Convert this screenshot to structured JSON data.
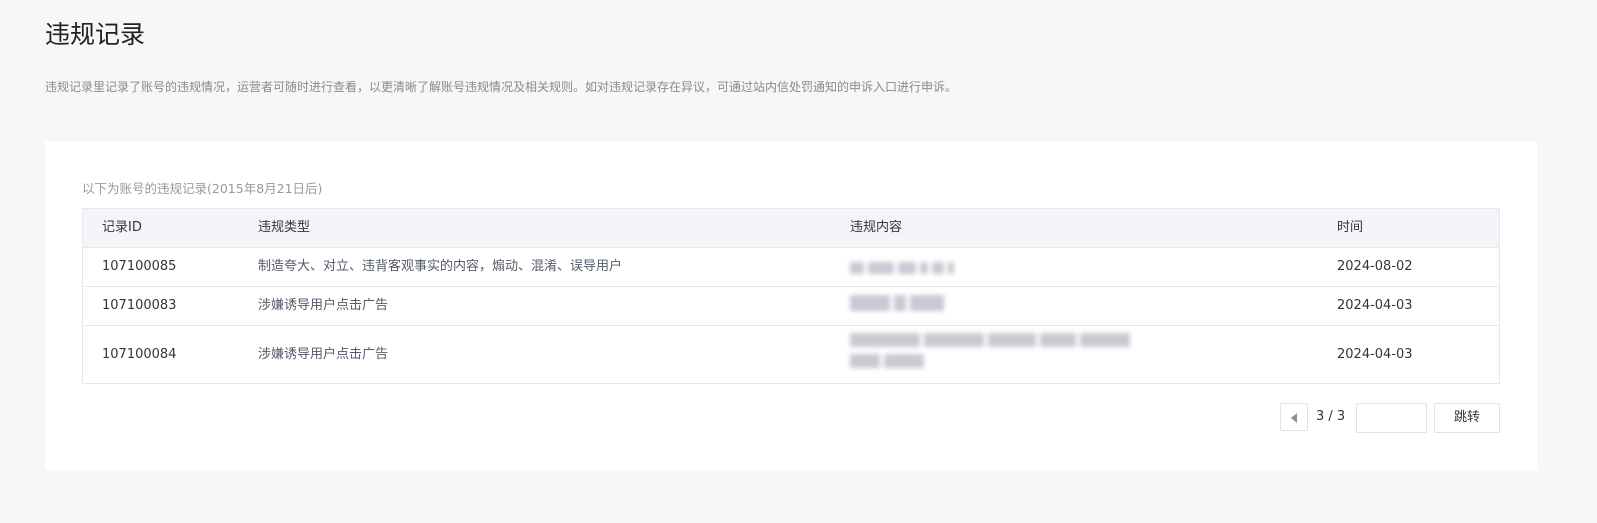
{
  "page": {
    "title": "违规记录",
    "description": "违规记录里记录了账号的违规情况，运营者可随时进行查看，以更清晰了解账号违规情况及相关规则。如对违规记录存在异议，可通过站内信处罚通知的申诉入口进行申诉。"
  },
  "records": {
    "caption": "以下为账号的违规记录(2015年8月21日后)",
    "columns": {
      "id": "记录ID",
      "type": "违规类型",
      "content": "违规内容",
      "time": "时间"
    },
    "rows": [
      {
        "id": "107100085",
        "type": "制造夸大、对立、违背客观事实的内容，煽动、混淆、误导用户",
        "time": "2024-08-02"
      },
      {
        "id": "107100083",
        "type": "涉嫌诱导用户点击广告",
        "time": "2024-04-03"
      },
      {
        "id": "107100084",
        "type": "涉嫌诱导用户点击广告",
        "time": "2024-04-03"
      }
    ]
  },
  "pagination": {
    "indicator": "3 / 3",
    "jump_label": "跳转",
    "jump_value": ""
  }
}
